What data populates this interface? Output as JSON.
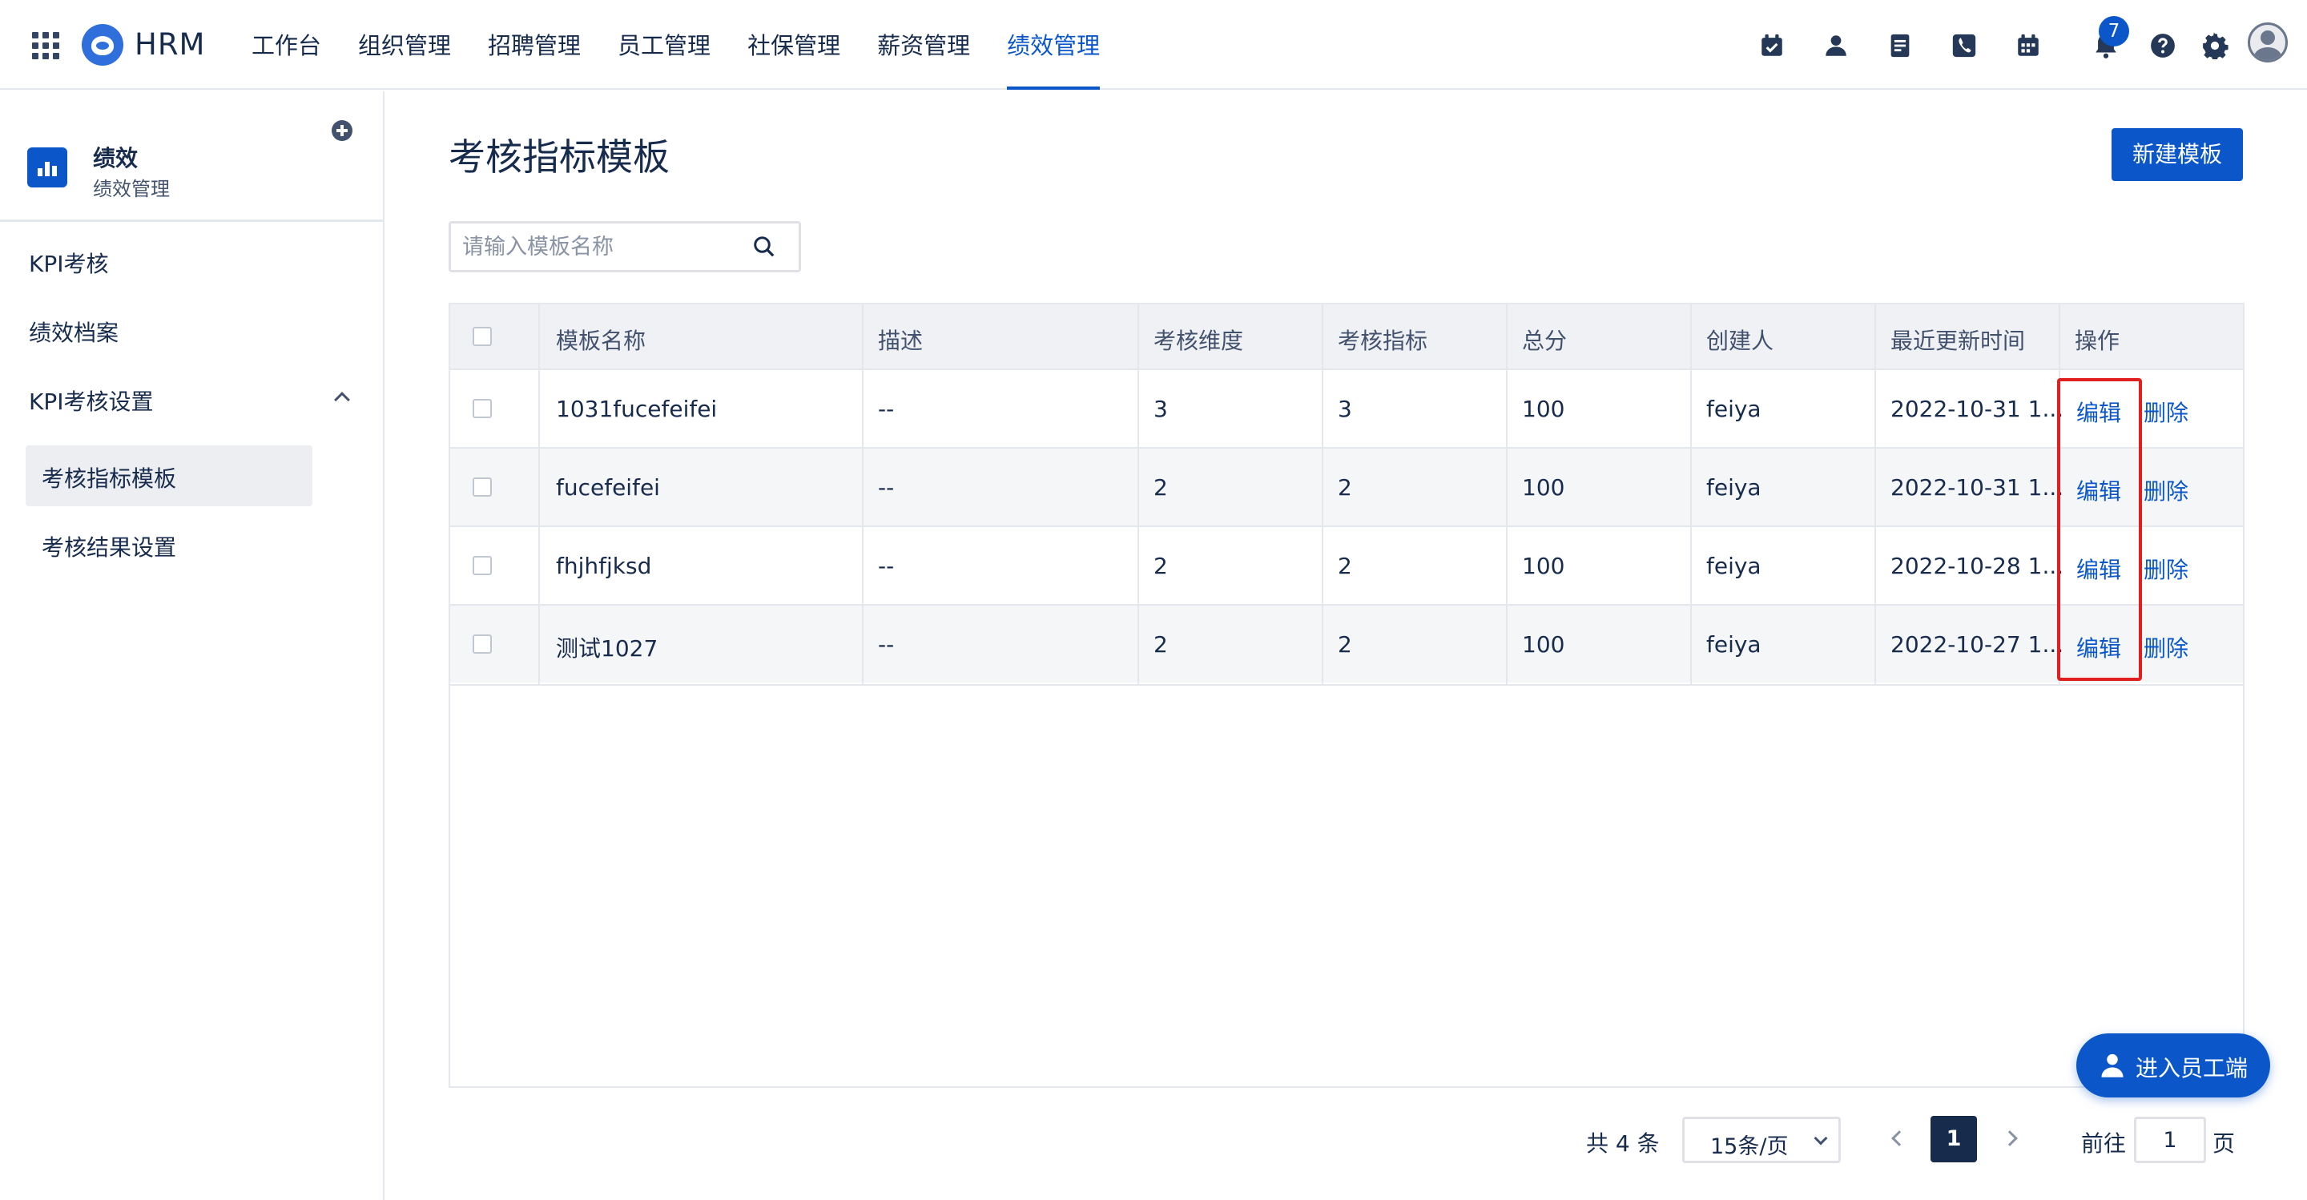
{
  "header": {
    "brand": "HRM",
    "nav": [
      {
        "label": "工作台"
      },
      {
        "label": "组织管理"
      },
      {
        "label": "招聘管理"
      },
      {
        "label": "员工管理"
      },
      {
        "label": "社保管理"
      },
      {
        "label": "薪资管理"
      },
      {
        "label": "绩效管理",
        "active": true
      }
    ],
    "notification_count": "7",
    "accent_color": "#0b57c9",
    "icons": [
      "apps-grid-icon",
      "calendar-check-icon",
      "user-icon",
      "document-icon",
      "phone-icon",
      "calendar-icon",
      "bell-icon",
      "help-icon",
      "gear-icon",
      "avatar"
    ]
  },
  "sidebar": {
    "module_title": "绩效",
    "module_subtitle": "绩效管理",
    "items": [
      {
        "label": "KPI考核"
      },
      {
        "label": "绩效档案"
      },
      {
        "label": "KPI考核设置",
        "expanded": true
      }
    ],
    "sub_items": [
      {
        "label": "考核指标模板",
        "active": true
      },
      {
        "label": "考核结果设置"
      }
    ]
  },
  "main": {
    "title": "考核指标模板",
    "new_button": "新建模板",
    "search_placeholder": "请输入模板名称",
    "columns": [
      "模板名称",
      "描述",
      "考核维度",
      "考核指标",
      "总分",
      "创建人",
      "最近更新时间",
      "操作"
    ],
    "rows": [
      {
        "name": "1031fucefeifei",
        "desc": "--",
        "dimensions": "3",
        "indicators": "3",
        "score": "100",
        "creator": "feiya",
        "updated": "2022-10-31 1..."
      },
      {
        "name": "fucefeifei",
        "desc": "--",
        "dimensions": "2",
        "indicators": "2",
        "score": "100",
        "creator": "feiya",
        "updated": "2022-10-31 1..."
      },
      {
        "name": "fhjhfjksd",
        "desc": "--",
        "dimensions": "2",
        "indicators": "2",
        "score": "100",
        "creator": "feiya",
        "updated": "2022-10-28 1..."
      },
      {
        "name": "测试1027",
        "desc": "--",
        "dimensions": "2",
        "indicators": "2",
        "score": "100",
        "creator": "feiya",
        "updated": "2022-10-27 1..."
      }
    ],
    "edit_label": "编辑",
    "delete_label": "删除",
    "highlight_color": "#e02020"
  },
  "pagination": {
    "total": "共 4 条",
    "page_size": "15条/页",
    "current_page": "1",
    "goto_label": "前往",
    "goto_value": "1",
    "page_suffix": "页"
  },
  "fab": {
    "label": "进入员工端"
  }
}
